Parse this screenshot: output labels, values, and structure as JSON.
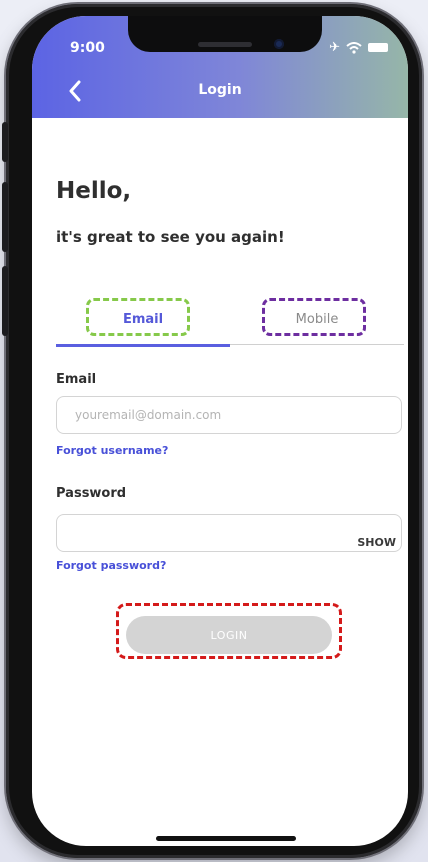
{
  "status_bar": {
    "time": "9:00",
    "airplane_icon": "airplane-icon",
    "wifi_icon": "wifi-icon",
    "battery_icon": "battery-icon"
  },
  "header": {
    "title": "Login",
    "back_icon": "chevron-left-icon",
    "gradient_colors": [
      "#5c64e4",
      "#96b6a8"
    ]
  },
  "greeting": {
    "title": "Hello,",
    "subtitle": "it's great to see you again!"
  },
  "tabs": [
    {
      "label": "Email",
      "active": true
    },
    {
      "label": "Mobile",
      "active": false
    }
  ],
  "form": {
    "email_label": "Email",
    "email_placeholder": "youremail@domain.com",
    "email_value": "",
    "forgot_username": "Forgot username?",
    "password_label": "Password",
    "password_value": "",
    "show_label": "SHOW",
    "forgot_password": "Forgot password?",
    "login_label": "LOGIN"
  },
  "colors": {
    "accent": "#5a5fe0",
    "link": "#4850d8",
    "button_disabled": "#d4d4d4",
    "highlight_email_tab": "#86c94a",
    "highlight_mobile_tab": "#6d2ea0",
    "highlight_login": "#d41a1a"
  }
}
